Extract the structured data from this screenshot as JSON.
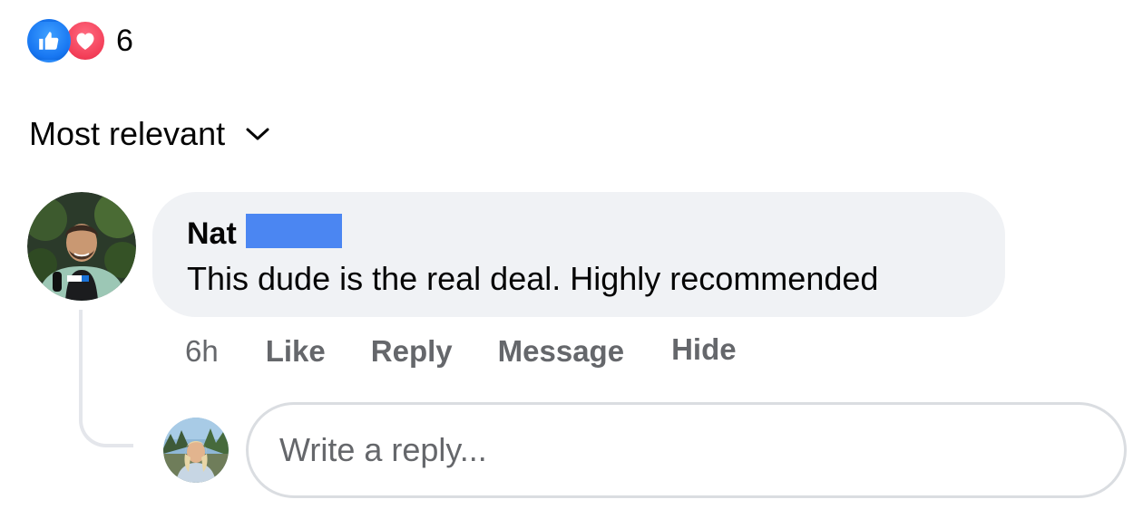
{
  "reactions": {
    "icons": [
      "like-icon",
      "love-icon"
    ],
    "count": "6",
    "colors": {
      "like": "#1877f2",
      "love": "#f33e58"
    }
  },
  "sort": {
    "label": "Most relevant",
    "icon": "chevron-down-icon"
  },
  "comment": {
    "author": "Nat",
    "author_surname_redacted": true,
    "redaction_color": "#4b86f2",
    "text": "This dude is the real deal. Highly recommended",
    "bubble_color": "#f0f2f5",
    "actions": {
      "time": "6h",
      "like": "Like",
      "reply": "Reply",
      "message": "Message",
      "hide": "Hide"
    }
  },
  "reply": {
    "placeholder": "Write a reply..."
  }
}
